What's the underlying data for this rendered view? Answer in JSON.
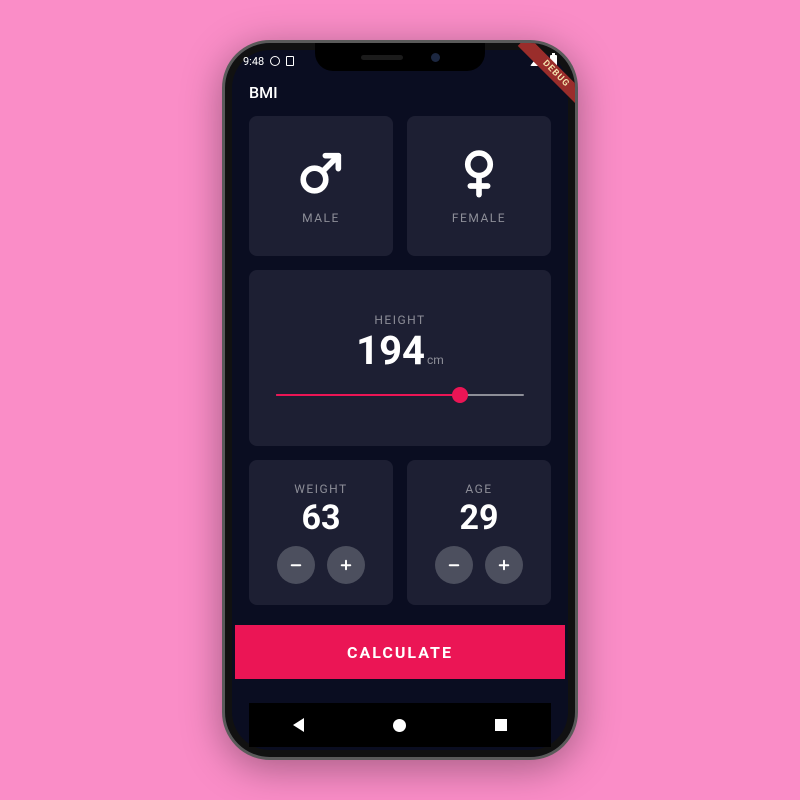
{
  "status": {
    "time": "9:48"
  },
  "debug_label": "DEBUG",
  "appbar": {
    "title": "BMI"
  },
  "gender": {
    "male": {
      "label": "MALE",
      "icon": "male-icon"
    },
    "female": {
      "label": "FEMALE",
      "icon": "female-icon"
    }
  },
  "height": {
    "label": "HEIGHT",
    "value": 194,
    "unit": "cm",
    "min": 120,
    "max": 220
  },
  "weight": {
    "label": "WEIGHT",
    "value": 63
  },
  "age": {
    "label": "AGE",
    "value": 29
  },
  "calculate_label": "CALCULATE",
  "colors": {
    "accent": "#eb1555",
    "card": "#1d1f33",
    "bg": "#0a0d21",
    "muted": "#8d8e98",
    "round": "#4c4f5e"
  }
}
